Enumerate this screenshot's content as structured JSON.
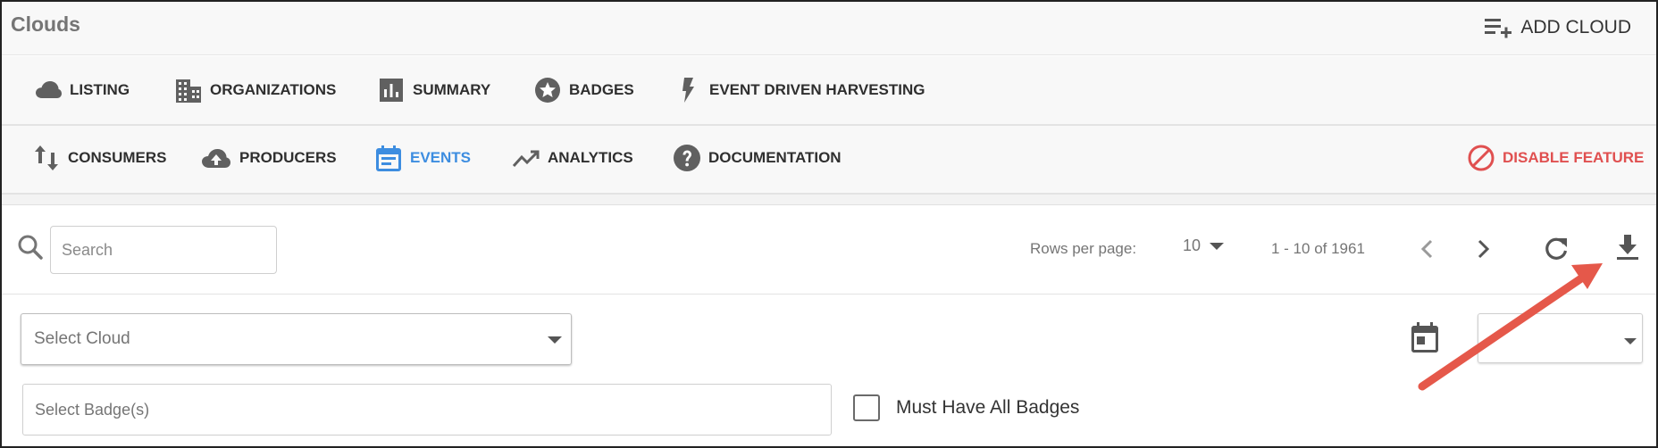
{
  "app": {
    "title": "Clouds",
    "add_label": "ADD CLOUD"
  },
  "nav_primary": [
    {
      "label": "LISTING",
      "icon": "cloud-icon"
    },
    {
      "label": "ORGANIZATIONS",
      "icon": "building-icon"
    },
    {
      "label": "SUMMARY",
      "icon": "bar-chart-icon"
    },
    {
      "label": "BADGES",
      "icon": "star-badge-icon"
    },
    {
      "label": "EVENT DRIVEN HARVESTING",
      "icon": "lightning-icon"
    }
  ],
  "nav_secondary": [
    {
      "label": "CONSUMERS",
      "icon": "arrows-up-down-icon"
    },
    {
      "label": "PRODUCERS",
      "icon": "cloud-upload-icon"
    },
    {
      "label": "EVENTS",
      "icon": "calendar-list-icon",
      "active": true
    },
    {
      "label": "ANALYTICS",
      "icon": "trending-up-icon"
    },
    {
      "label": "DOCUMENTATION",
      "icon": "help-circle-icon"
    }
  ],
  "disable_feature": {
    "label": "DISABLE FEATURE",
    "icon": "block-icon",
    "color": "#e05050"
  },
  "toolbar": {
    "search_placeholder": "Search",
    "rows_label": "Rows per page:",
    "rows_value": "10",
    "page_range": "1 - 10 of 1961"
  },
  "filters": {
    "select_cloud_placeholder": "Select Cloud",
    "select_badges_placeholder": "Select Badge(s)",
    "must_have_all_label": "Must Have All Badges",
    "date_value": ""
  },
  "colors": {
    "accent": "#3d8de0",
    "danger": "#e05050",
    "annotation_arrow": "#e5584a"
  }
}
